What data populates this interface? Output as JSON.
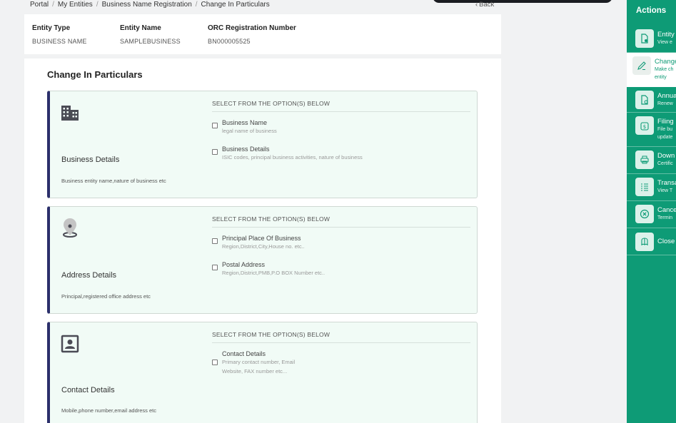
{
  "breadcrumb": [
    "Portal",
    "My Entities",
    "Business Name Registration",
    "Change In Particulars"
  ],
  "back_label": "Back",
  "entity": {
    "type_label": "Entity Type",
    "type_value": "BUSINESS NAME",
    "name_label": "Entity Name",
    "name_value": "SAMPLEBUSINESS",
    "orc_label": "ORC Registration Number",
    "orc_value": "BN000005525"
  },
  "page_title": "Change In Particulars",
  "select_heading": "SELECT FROM THE OPTION(S) BELOW",
  "categories": [
    {
      "icon": "building-icon",
      "title": "Business Details",
      "description": "Business entity name,nature of business etc",
      "options": [
        {
          "title": "Business Name",
          "subtitle": "legal name of business"
        },
        {
          "title": "Business Details",
          "subtitle": "ISIC codes, principal business activities, nature of business"
        }
      ]
    },
    {
      "icon": "location-pin-icon",
      "title": "Address Details",
      "description": "Principal,registered office address etc",
      "options": [
        {
          "title": "Principal Place Of Business",
          "subtitle": "Region,District,City,House no. etc.."
        },
        {
          "title": "Postal Address",
          "subtitle": "Region,District,PMB,P.O BOX Number etc.."
        }
      ]
    },
    {
      "icon": "contact-card-icon",
      "title": "Contact Details",
      "description": "Mobile,phone number,email address etc",
      "options": [
        {
          "title": "Contact Details",
          "subtitle_line1": "Primary contact number, Email",
          "subtitle_line2": "Website, FAX number etc..."
        }
      ]
    }
  ],
  "sidebar": {
    "heading": "Actions",
    "items": [
      {
        "title": "Entity",
        "desc": "View e",
        "icon": "document-icon"
      },
      {
        "title": "Change",
        "desc": "Make ch",
        "desc2": "entity",
        "icon": "pencil-icon"
      },
      {
        "title": "Annua",
        "desc": "Renew",
        "icon": "document-refresh-icon"
      },
      {
        "title": "Filing",
        "desc": "File bu",
        "desc2": "update",
        "icon": "money-bag-icon"
      },
      {
        "title": "Down",
        "desc": "Certific",
        "icon": "printer-icon"
      },
      {
        "title": "Transa",
        "desc": "View T",
        "icon": "list-icon"
      },
      {
        "title": "Cance",
        "desc": "Termin",
        "icon": "cancel-circle-icon"
      },
      {
        "title": "Close",
        "icon": "book-icon"
      }
    ]
  },
  "colors": {
    "accent": "#0e9b76",
    "card_bg": "#f1fbf6",
    "card_border": "#2b2f6b"
  }
}
